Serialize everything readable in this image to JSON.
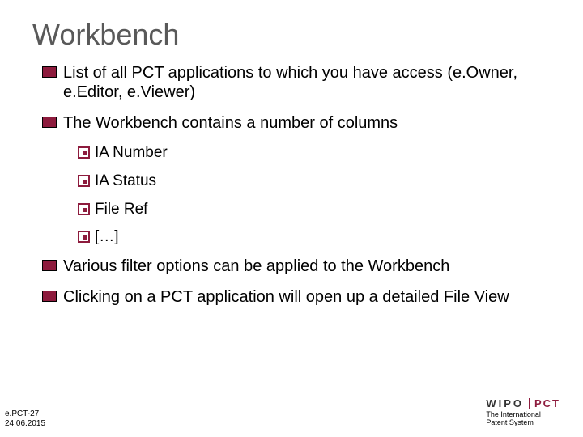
{
  "title": "Workbench",
  "bullets": {
    "b0": "List of all PCT applications to which you have access (e.Owner, e.Editor, e.Viewer)",
    "b1": "The Workbench contains a number of columns",
    "sub0": "IA Number",
    "sub1": "IA Status",
    "sub2": "File Ref",
    "sub3": "[…]",
    "b2": "Various filter options can be applied to the Workbench",
    "b3": "Clicking on a PCT application will open up a detailed File View"
  },
  "footer": {
    "ref": "e.PCT-27",
    "date": "24.06.2015",
    "brand1": "WIPO",
    "brand2": "PCT",
    "tagline1": "The International",
    "tagline2": "Patent System"
  }
}
